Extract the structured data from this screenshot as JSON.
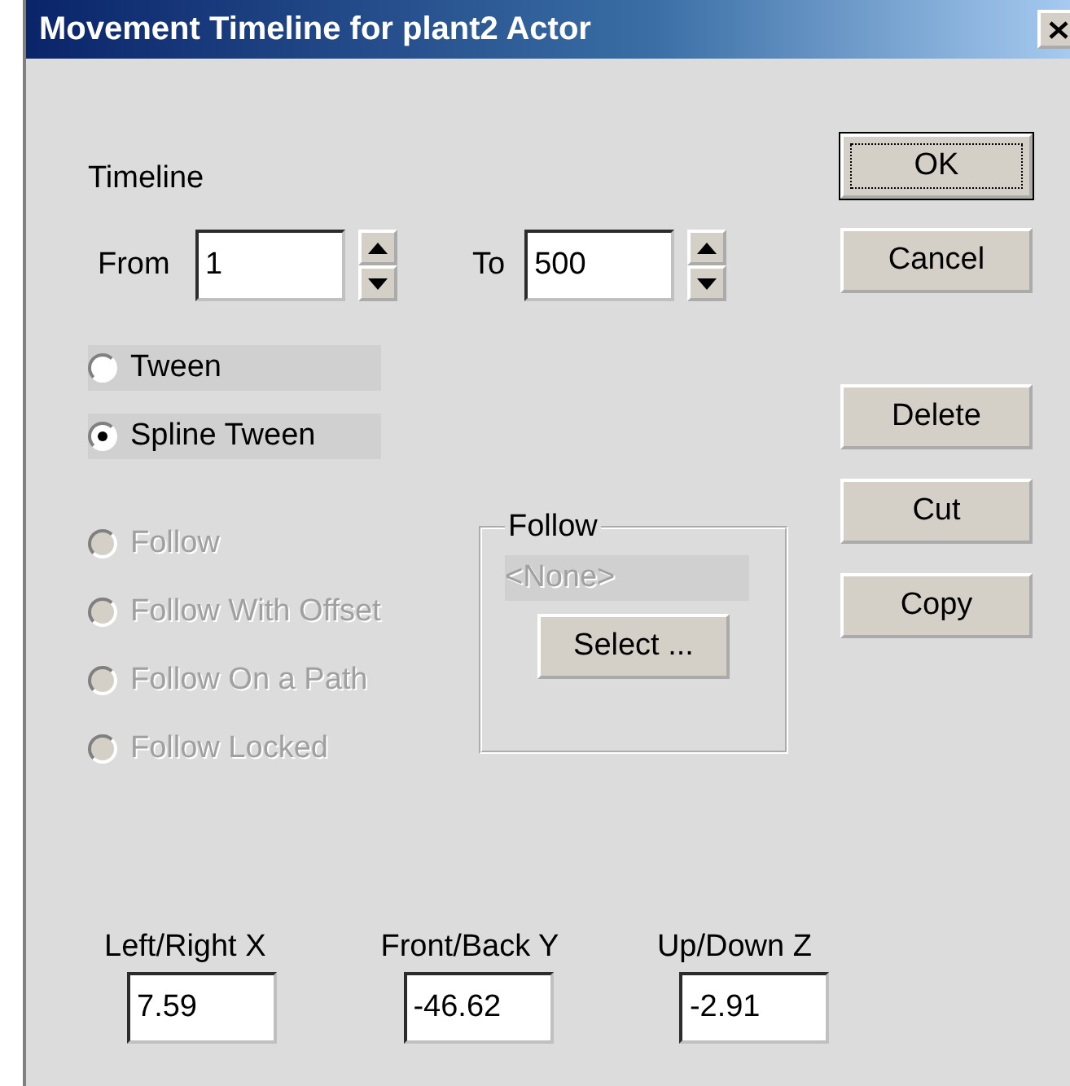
{
  "window": {
    "title": "Movement Timeline for plant2 Actor"
  },
  "timeline": {
    "label": "Timeline",
    "from_label": "From",
    "from_value": "1",
    "to_label": "To",
    "to_value": "500"
  },
  "modes": [
    {
      "label": "Tween",
      "selected": false,
      "disabled": false
    },
    {
      "label": "Spline Tween",
      "selected": true,
      "disabled": false
    },
    {
      "label": "Follow",
      "selected": false,
      "disabled": true
    },
    {
      "label": "Follow With Offset",
      "selected": false,
      "disabled": true
    },
    {
      "label": "Follow On a Path",
      "selected": false,
      "disabled": true
    },
    {
      "label": "Follow Locked",
      "selected": false,
      "disabled": true
    }
  ],
  "follow_group": {
    "title": "Follow",
    "target": "<None>",
    "target_disabled": true,
    "select_button": "Select ..."
  },
  "coordinates": [
    {
      "label": "Left/Right X",
      "value": "7.59"
    },
    {
      "label": "Front/Back Y",
      "value": "-46.62"
    },
    {
      "label": "Up/Down Z",
      "value": "-2.91"
    }
  ],
  "buttons": [
    {
      "label": "OK",
      "default": true
    },
    {
      "label": "Cancel",
      "default": false
    },
    {
      "label": "Delete",
      "default": false
    },
    {
      "label": "Cut",
      "default": false
    },
    {
      "label": "Copy",
      "default": false
    }
  ]
}
